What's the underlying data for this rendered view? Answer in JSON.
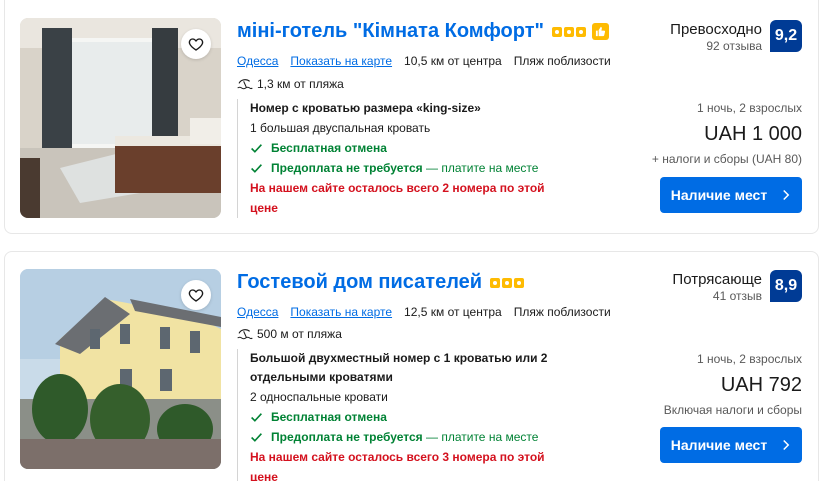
{
  "listings": [
    {
      "name": "міні-готель \"Кімната Комфорт\"",
      "stars": 3,
      "preferred_badge": "thumbs-up-icon",
      "city": "Одесса",
      "map_link": "Показать на карте",
      "distance_center": "10,5 км от центра",
      "beach_tag": "Пляж поблизости",
      "beach_distance": "1,3 км от пляжа",
      "room_title": "Номер с кроватью размера «king-size»",
      "room_beds": "1 большая двуспальная кровать",
      "free_cancel": "Бесплатная отмена",
      "no_prepay": "Предоплата не требуется",
      "no_prepay_rest": " — платите на месте",
      "scarcity": "На нашем сайте осталось всего 2 номера по этой цене",
      "rating_word": "Превосходно",
      "reviews": "92 отзыва",
      "score": "9,2",
      "nights": "1 ночь, 2 взрослых",
      "price": "UAH 1 000",
      "taxes": "+ налоги и сборы (UAH 80)",
      "button": "Наличие мест"
    },
    {
      "name": "Гостевой дом писателей",
      "stars": 3,
      "city": "Одесса",
      "map_link": "Показать на карте",
      "distance_center": "12,5 км от центра",
      "beach_tag": "Пляж поблизости",
      "beach_distance": "500 м от пляжа",
      "room_title": "Большой двухместный номер с 1 кроватью или 2 отдельными кроватями",
      "room_beds": "2 односпальные кровати",
      "free_cancel": "Бесплатная отмена",
      "no_prepay": "Предоплата не требуется",
      "no_prepay_rest": " — платите на месте",
      "scarcity": "На нашем сайте осталось всего 3 номера по этой цене",
      "rating_word": "Потрясающе",
      "reviews": "41 отзыв",
      "score": "8,9",
      "nights": "1 ночь, 2 взрослых",
      "price": "UAH 792",
      "taxes": "Включая налоги и сборы",
      "button": "Наличие мест"
    }
  ],
  "colors": {
    "link": "#006ce4",
    "score_bg": "#003b95",
    "green": "#008234",
    "red": "#d4111e",
    "star": "#febb02"
  }
}
